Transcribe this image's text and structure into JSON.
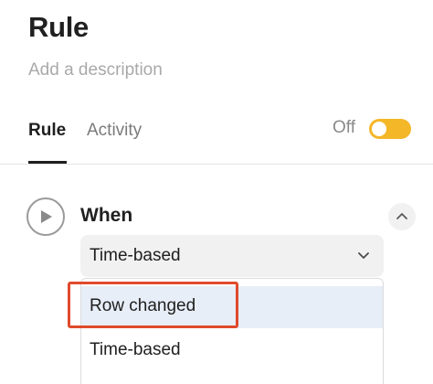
{
  "header": {
    "title": "Rule",
    "description_placeholder": "Add a description"
  },
  "tabs": [
    {
      "label": "Rule",
      "active": true
    },
    {
      "label": "Activity",
      "active": false
    }
  ],
  "toggle": {
    "label": "Off",
    "state": "off",
    "color": "#f4b728"
  },
  "trigger": {
    "label": "When",
    "play_icon": "play-icon",
    "collapse_icon": "chevron-up-icon",
    "select": {
      "value": "Time-based",
      "icon": "chevron-down-icon"
    },
    "options": [
      {
        "label": "Row changed",
        "highlighted": true
      },
      {
        "label": "Time-based",
        "highlighted": false
      }
    ]
  },
  "annotation": {
    "color": "#e04a2c"
  }
}
